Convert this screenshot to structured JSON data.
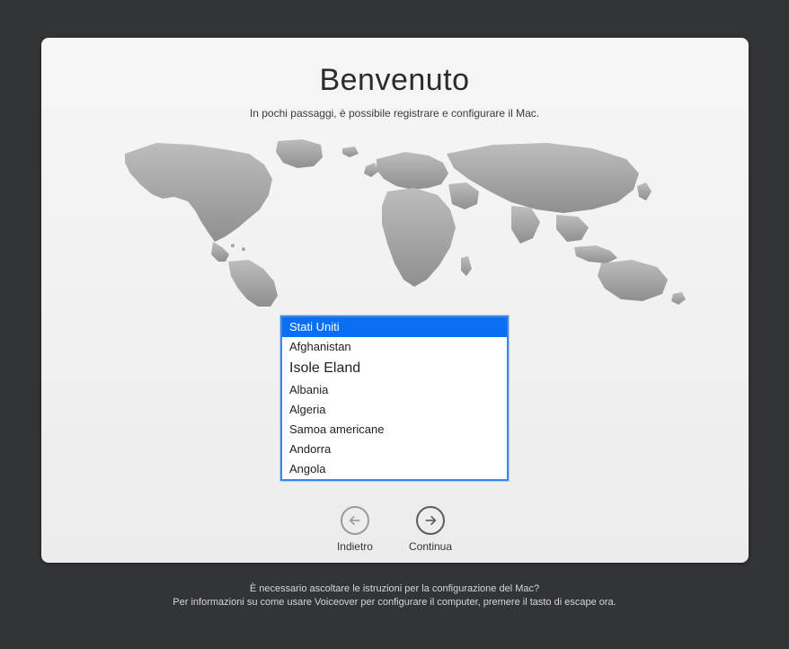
{
  "title": "Benvenuto",
  "subtitle": "In pochi passaggi, è possibile registrare e configurare il Mac.",
  "countries": [
    {
      "label": "Stati Uniti",
      "selected": true,
      "large": false
    },
    {
      "label": "Afghanistan",
      "selected": false,
      "large": false
    },
    {
      "label": "Isole Eland",
      "selected": false,
      "large": true
    },
    {
      "label": "Albania",
      "selected": false,
      "large": false
    },
    {
      "label": "Algeria",
      "selected": false,
      "large": false
    },
    {
      "label": "Samoa americane",
      "selected": false,
      "large": false
    },
    {
      "label": "Andorra",
      "selected": false,
      "large": false
    },
    {
      "label": "Angola",
      "selected": false,
      "large": false
    }
  ],
  "buttons": {
    "back": "Indietro",
    "continue": "Continua"
  },
  "footer": {
    "line1": "È necessario ascoltare le istruzioni per la configurazione del Mac?",
    "line2": "Per informazioni su come usare Voiceover per configurare il computer, premere il tasto di escape ora."
  }
}
